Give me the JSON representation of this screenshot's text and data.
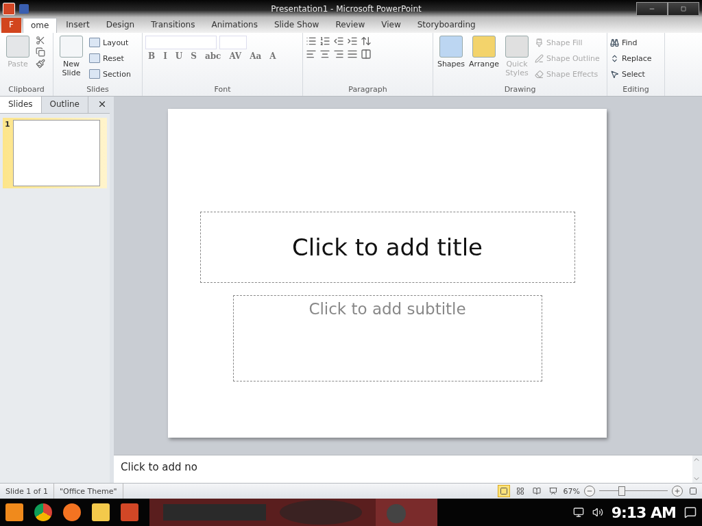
{
  "title_bar": {
    "title": "Presentation1 - Microsoft PowerPoint"
  },
  "tabs": [
    {
      "label": "F",
      "selected": false,
      "kind": "file"
    },
    {
      "label": "ome",
      "selected": true,
      "kind": "tab"
    },
    {
      "label": "Insert",
      "selected": false,
      "kind": "tab"
    },
    {
      "label": "Design",
      "selected": false,
      "kind": "tab"
    },
    {
      "label": "Transitions",
      "selected": false,
      "kind": "tab"
    },
    {
      "label": "Animations",
      "selected": false,
      "kind": "tab"
    },
    {
      "label": "Slide Show",
      "selected": false,
      "kind": "tab"
    },
    {
      "label": "Review",
      "selected": false,
      "kind": "tab"
    },
    {
      "label": "View",
      "selected": false,
      "kind": "tab"
    },
    {
      "label": "Storyboarding",
      "selected": false,
      "kind": "tab"
    }
  ],
  "ribbon": {
    "clipboard": {
      "label": "Clipboard",
      "paste": {
        "label": "Paste",
        "disabled": true
      }
    },
    "slides": {
      "label": "Slides",
      "new_slide": "New Slide",
      "commands": [
        {
          "label": "Layout"
        },
        {
          "label": "Reset"
        },
        {
          "label": "Section"
        }
      ]
    },
    "font": {
      "label": "Font",
      "format_buttons": [
        "B",
        "I",
        "U",
        "S",
        "abc",
        "AV",
        "Aa",
        "A"
      ]
    },
    "paragraph": {
      "label": "Paragraph"
    },
    "drawing": {
      "label": "Drawing",
      "large": [
        {
          "label": "Shapes",
          "disabled": false
        },
        {
          "label": "Arrange",
          "disabled": false
        },
        {
          "label": "Quick Styles",
          "disabled": true
        }
      ],
      "commands": [
        {
          "label": "Shape Fill",
          "disabled": true
        },
        {
          "label": "Shape Outline",
          "disabled": true
        },
        {
          "label": "Shape Effects",
          "disabled": true
        }
      ]
    },
    "editing": {
      "label": "Editing",
      "commands": [
        {
          "label": "Find"
        },
        {
          "label": "Replace"
        },
        {
          "label": "Select"
        }
      ]
    }
  },
  "slides_panel": {
    "tabs": [
      {
        "label": "Slides",
        "selected": true
      },
      {
        "label": "Outline",
        "selected": false
      }
    ],
    "thumbnails": [
      {
        "number": "1",
        "selected": true
      }
    ]
  },
  "slide": {
    "title": "Click to add title",
    "subtitle": "Click to add subtitle"
  },
  "notes": {
    "prompt": "Click to add no"
  },
  "status_bar": {
    "slide_info": "Slide 1 of 1",
    "theme": "\"Office Theme\"",
    "views": [
      {
        "selected": true
      },
      {
        "selected": false
      },
      {
        "selected": false
      },
      {
        "selected": false
      }
    ],
    "zoom": "67%",
    "zoom_slider": {
      "level": 0.33
    }
  },
  "taskbar": {
    "time": "9:13 AM"
  }
}
